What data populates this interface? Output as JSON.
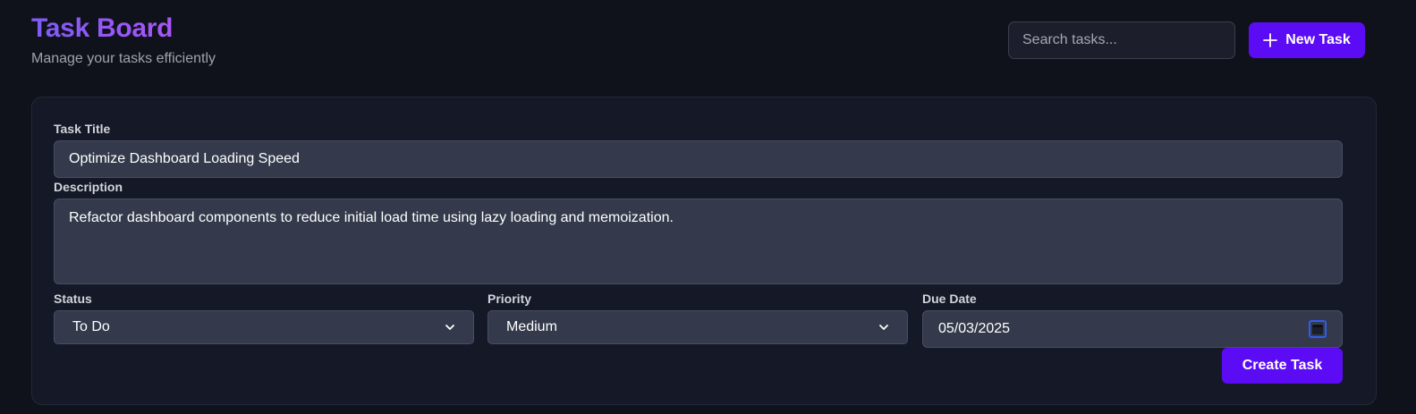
{
  "header": {
    "title": "Task Board",
    "subtitle": "Manage your tasks efficiently",
    "search_placeholder": "Search tasks...",
    "new_task_label": "New Task"
  },
  "form": {
    "title_label": "Task Title",
    "title_value": "Optimize Dashboard Loading Speed",
    "description_label": "Description",
    "description_value": "Refactor dashboard components to reduce initial load time using lazy loading and memoization.",
    "status_label": "Status",
    "status_value": "To Do",
    "priority_label": "Priority",
    "priority_value": "Medium",
    "due_date_label": "Due Date",
    "due_date_value": "05/03/2025",
    "create_label": "Create Task"
  },
  "icons": {
    "new_task": "plus-icon",
    "select_arrow": "chevron-down-icon",
    "date_picker": "calendar-icon"
  },
  "colors": {
    "background": "#10121b",
    "accent": "#5b0cf5",
    "title_gradient_start": "#7c5cf5",
    "title_gradient_end": "#a855f7"
  }
}
